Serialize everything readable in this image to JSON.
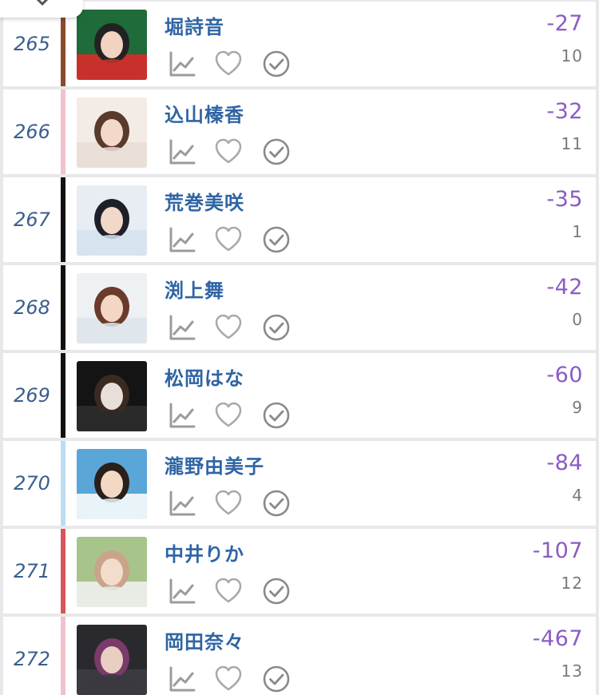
{
  "rows": [
    {
      "rank": "265",
      "name": "堀詩音",
      "score": "-27",
      "count": "10",
      "bar_color": "#8b4a2b",
      "photo_palette": [
        "#1f6b3a",
        "#c8302c",
        "#222222",
        "#f2d2c0"
      ]
    },
    {
      "rank": "266",
      "name": "込山榛香",
      "score": "-32",
      "count": "11",
      "bar_color": "#f2c1cc",
      "photo_palette": [
        "#f3ece6",
        "#e9dfd6",
        "#5a3a2a",
        "#f4d9c8"
      ]
    },
    {
      "rank": "267",
      "name": "荒巻美咲",
      "score": "-35",
      "count": "1",
      "bar_color": "#111111",
      "photo_palette": [
        "#e8edf3",
        "#d7e3ee",
        "#1f1f2a",
        "#f2d8c8"
      ]
    },
    {
      "rank": "268",
      "name": "渕上舞",
      "score": "-42",
      "count": "0",
      "bar_color": "#111111",
      "photo_palette": [
        "#eef1f4",
        "#dfe6ec",
        "#6a3a2a",
        "#f3d6c4"
      ]
    },
    {
      "rank": "269",
      "name": "松岡はな",
      "score": "-60",
      "count": "9",
      "bar_color": "#111111",
      "photo_palette": [
        "#141414",
        "#2a2a2a",
        "#3a2a22",
        "#e8e0d8"
      ]
    },
    {
      "rank": "270",
      "name": "瀧野由美子",
      "score": "-84",
      "count": "4",
      "bar_color": "#bcdcf2",
      "photo_palette": [
        "#5aa6d8",
        "#e9f3f8",
        "#2a1f1a",
        "#f3d8c6"
      ]
    },
    {
      "rank": "271",
      "name": "中井りか",
      "score": "-107",
      "count": "12",
      "bar_color": "#d9545c",
      "photo_palette": [
        "#a8c48a",
        "#e9ece4",
        "#c9a48a",
        "#f2dccc"
      ]
    },
    {
      "rank": "272",
      "name": "岡田奈々",
      "score": "-467",
      "count": "13",
      "bar_color": "#f2c1cc",
      "photo_palette": [
        "#2a2a2e",
        "#3a3a40",
        "#7a3a6a",
        "#e8cfc2"
      ]
    }
  ],
  "icons": {
    "chart": "chart-icon",
    "heart": "heart-icon",
    "check": "check-circle-icon",
    "close": "close-icon"
  },
  "colors": {
    "name": "#2f64a4",
    "rank": "#3a5f8f",
    "score": "#8a5cc4",
    "count": "#7a7a7a",
    "icon": "#9b9b9b"
  }
}
